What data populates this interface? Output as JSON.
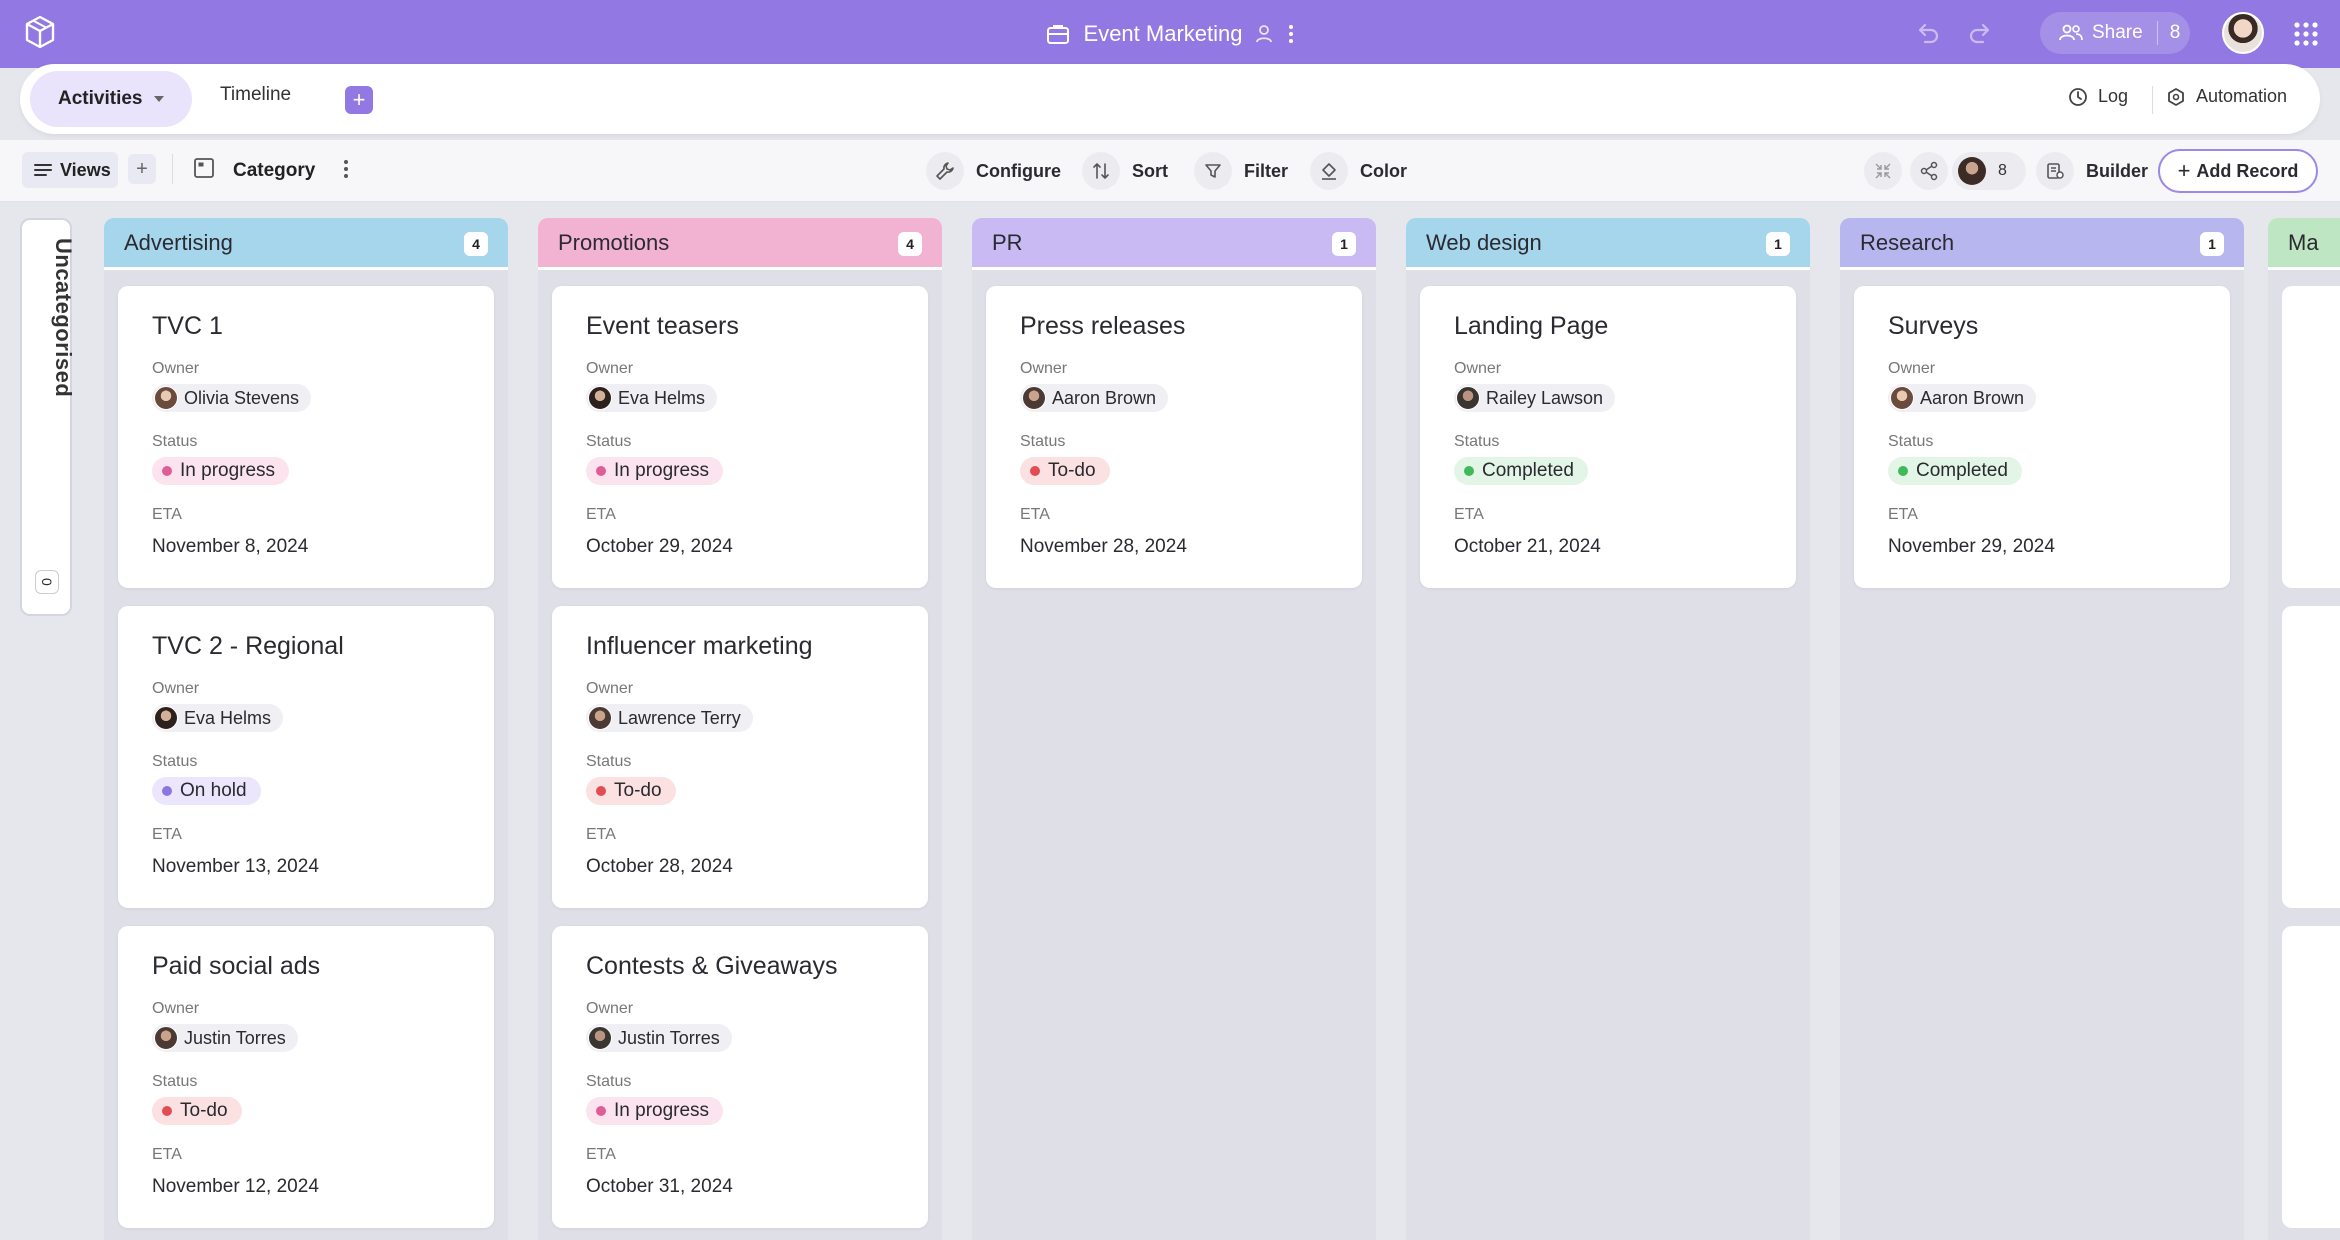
{
  "app": {
    "title": "Event Marketing",
    "share_label": "Share",
    "share_count": "8"
  },
  "tabs": {
    "active": "Activities",
    "other": "Timeline",
    "add": "+",
    "log": "Log",
    "automation": "Automation"
  },
  "toolbar": {
    "views": "Views",
    "add": "+",
    "category": "Category",
    "configure": "Configure",
    "sort": "Sort",
    "filter": "Filter",
    "color": "Color",
    "collaborators_count": "8",
    "builder": "Builder",
    "add_record": "Add Record"
  },
  "labels": {
    "owner": "Owner",
    "status": "Status",
    "eta": "ETA"
  },
  "uncategorised": {
    "label": "Uncategorised",
    "count": "0"
  },
  "status_colors": {
    "In progress": {
      "dot": "#e05c96",
      "bg": "#fbe4ee"
    },
    "On hold": {
      "dot": "#8c76e0",
      "bg": "#ebe6fb"
    },
    "To-do": {
      "dot": "#e04d52",
      "bg": "#fbe1e2"
    },
    "Completed": {
      "dot": "#3fb959",
      "bg": "#e3f5e6"
    }
  },
  "columns": [
    {
      "name": "Advertising",
      "count": "4",
      "color": "#a6d6ec",
      "cards": [
        {
          "title": "TVC 1",
          "owner": "Olivia Stevens",
          "status": "In progress",
          "eta": "November 8, 2024"
        },
        {
          "title": "TVC 2 - Regional",
          "owner": "Eva Helms",
          "status": "On hold",
          "eta": "November 13, 2024"
        },
        {
          "title": "Paid social ads",
          "owner": "Justin Torres",
          "status": "To-do",
          "eta": "November 12, 2024"
        }
      ]
    },
    {
      "name": "Promotions",
      "count": "4",
      "color": "#f2b3d3",
      "cards": [
        {
          "title": "Event teasers",
          "owner": "Eva Helms",
          "status": "In progress",
          "eta": "October 29, 2024"
        },
        {
          "title": "Influencer marketing",
          "owner": "Lawrence Terry",
          "status": "To-do",
          "eta": "October 28, 2024"
        },
        {
          "title": "Contests & Giveaways",
          "owner": "Justin Torres",
          "status": "In progress",
          "eta": "October 31, 2024"
        }
      ]
    },
    {
      "name": "PR",
      "count": "1",
      "color": "#c9baf4",
      "cards": [
        {
          "title": "Press releases",
          "owner": "Aaron Brown",
          "status": "To-do",
          "eta": "November 28, 2024"
        }
      ]
    },
    {
      "name": "Web design",
      "count": "1",
      "color": "#a6d6ec",
      "cards": [
        {
          "title": "Landing Page",
          "owner": "Railey Lawson",
          "status": "Completed",
          "eta": "October 21, 2024"
        }
      ]
    },
    {
      "name": "Research",
      "count": "1",
      "color": "#b8b6ef",
      "cards": [
        {
          "title": "Surveys",
          "owner": "Aaron Brown",
          "status": "Completed",
          "eta": "November 29, 2024"
        }
      ]
    }
  ],
  "partial_column": {
    "name": "Ma",
    "color": "#bfe6c3"
  }
}
